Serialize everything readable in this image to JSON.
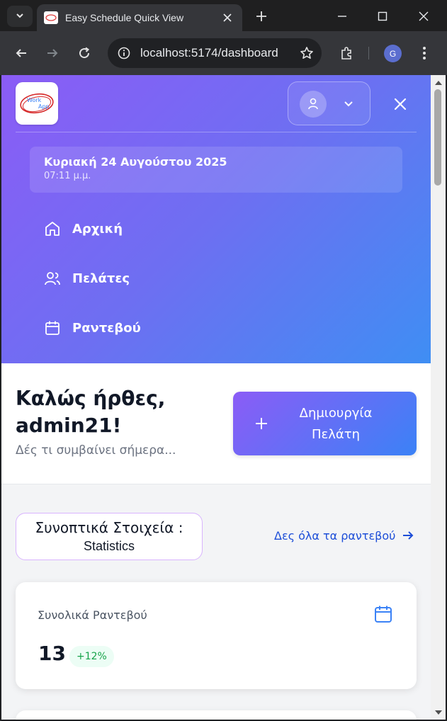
{
  "browser": {
    "tab_title": "Easy Schedule Quick View",
    "url": "localhost:5174/dashboard",
    "profile_initial": "G"
  },
  "logo": {
    "line1": "Work",
    "line2": "App"
  },
  "menu": {
    "date": "Κυριακή 24 Αυγούστου 2025",
    "time": "07:11 μ.μ.",
    "items": [
      {
        "label": "Αρχική",
        "icon": "home-icon"
      },
      {
        "label": "Πελάτες",
        "icon": "users-icon"
      },
      {
        "label": "Ραντεβού",
        "icon": "calendar-icon"
      }
    ]
  },
  "welcome": {
    "title": "Καλώς ήρθες, admin21!",
    "subtitle": "Δές τι συμβαίνει σήμερα...",
    "create_button_label": "Δημιουργία Πελάτη"
  },
  "stats": {
    "title": "Συνοπτικά Στοιχεία :",
    "subtitle": "Statistics",
    "view_all_label": "Δες όλα τα ραντεβού"
  },
  "cards": [
    {
      "label": "Συνολικά Ραντεβού",
      "value": "13",
      "change": "+12%",
      "icon": "calendar-icon"
    }
  ],
  "colors": {
    "gradient_start": "#8b5cf6",
    "gradient_end": "#3b82f6",
    "link": "#1d4ed8",
    "positive": "#16a34a"
  }
}
